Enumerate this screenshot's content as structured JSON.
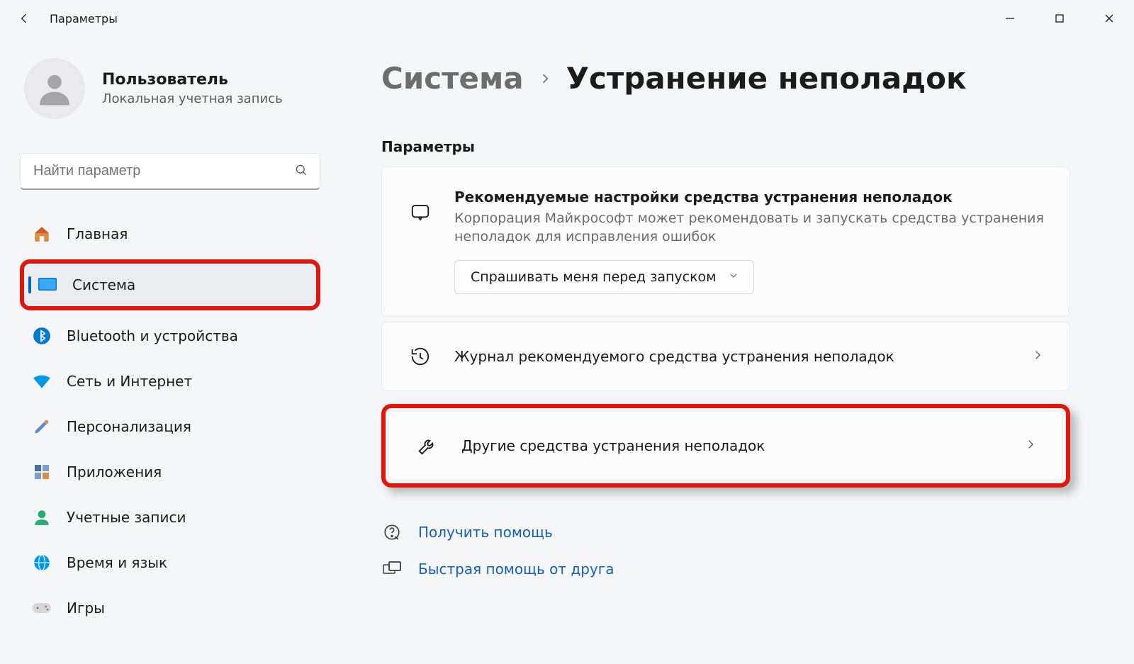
{
  "app_title": "Параметры",
  "user": {
    "name": "Пользователь",
    "subtitle": "Локальная учетная запись"
  },
  "search": {
    "placeholder": "Найти параметр"
  },
  "sidebar": {
    "items": [
      {
        "label": "Главная"
      },
      {
        "label": "Система"
      },
      {
        "label": "Bluetooth и устройства"
      },
      {
        "label": "Сеть и Интернет"
      },
      {
        "label": "Персонализация"
      },
      {
        "label": "Приложения"
      },
      {
        "label": "Учетные записи"
      },
      {
        "label": "Время и язык"
      },
      {
        "label": "Игры"
      }
    ]
  },
  "breadcrumb": {
    "parent": "Система",
    "current": "Устранение неполадок"
  },
  "section": {
    "title": "Параметры"
  },
  "panel_recommended": {
    "title": "Рекомендуемые настройки средства устранения неполадок",
    "subtitle": "Корпорация Майкрософт может рекомендовать и запускать средства устранения неполадок для исправления ошибок",
    "dropdown_value": "Спрашивать меня перед запуском"
  },
  "panel_history": {
    "title": "Журнал рекомендуемого средства устранения неполадок"
  },
  "panel_other": {
    "title": "Другие средства устранения неполадок"
  },
  "help": {
    "get_help": "Получить помощь",
    "quick_assist": "Быстрая помощь от друга"
  }
}
